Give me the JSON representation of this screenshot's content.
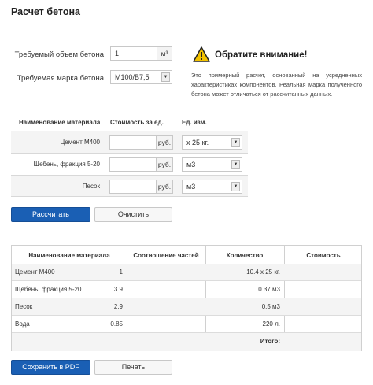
{
  "page_title": "Расчет бетона",
  "form": {
    "volume_label": "Требуемый объем бетона",
    "volume_value": "1",
    "volume_unit": "м³",
    "grade_label": "Требуемая марка бетона",
    "grade_value": "М100/В7,5"
  },
  "notice": {
    "title": "Обратите внимание!",
    "text": "Это примерный расчет, основанный на усредненных характеристиках компонентов. Реальная марка полученного бетона может отличаться от рассчитанных данных."
  },
  "materials": {
    "headers": [
      "Наименование материала",
      "Стоимость за ед.",
      "Ед. изм."
    ],
    "currency": "руб.",
    "rows": [
      {
        "name": "Цемент М400",
        "price": "",
        "unit": "х 25 кг."
      },
      {
        "name": "Щебень, фракция 5-20",
        "price": "",
        "unit": "м3"
      },
      {
        "name": "Песок",
        "price": "",
        "unit": "м3"
      }
    ]
  },
  "buttons": {
    "calculate": "Рассчитать",
    "clear": "Очистить",
    "save_pdf": "Сохранить в PDF",
    "print": "Печать"
  },
  "results": {
    "headers": [
      "Наименование материала",
      "Соотношение частей",
      "Количество",
      "Стоимость"
    ],
    "rows": [
      {
        "name": "Цемент М400",
        "ratio": "1",
        "qty": "10.4 х 25 кг.",
        "cost": ""
      },
      {
        "name": "Щебень, фракция 5-20",
        "ratio": "3.9",
        "qty": "0.37 м3",
        "cost": ""
      },
      {
        "name": "Песок",
        "ratio": "2.9",
        "qty": "0.5 м3",
        "cost": ""
      },
      {
        "name": "Вода",
        "ratio": "0.85",
        "qty": "220 л.",
        "cost": ""
      }
    ],
    "total_label": "Итого:",
    "total_value": ""
  },
  "icons": {
    "warning": "warning-icon",
    "dropdown": "chevron-down-icon"
  },
  "colors": {
    "primary": "#1a5fb4",
    "warning": "#f2c200"
  }
}
